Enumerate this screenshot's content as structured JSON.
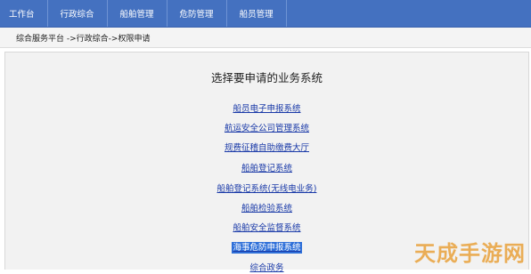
{
  "nav": {
    "tabs": [
      "工作台",
      "行政综合",
      "船舶管理",
      "危防管理",
      "船员管理"
    ]
  },
  "breadcrumb": "综合服务平台 ->行政综合->权限申请",
  "main": {
    "heading": "选择要申请的业务系统",
    "systems": [
      {
        "label": "船员电子申报系统",
        "selected": false
      },
      {
        "label": "航运安全公司管理系统",
        "selected": false
      },
      {
        "label": "规费征稽自助缴费大厅",
        "selected": false
      },
      {
        "label": "船舶登记系统",
        "selected": false
      },
      {
        "label": "船舶登记系统(无线电业务)",
        "selected": false
      },
      {
        "label": "船舶检验系统",
        "selected": false
      },
      {
        "label": "船舶安全监督系统",
        "selected": false
      },
      {
        "label": "海事危防申报系统",
        "selected": true
      },
      {
        "label": "综合政务",
        "selected": false
      }
    ]
  },
  "watermark": "天成手游网",
  "colors": {
    "nav_bg": "#4471c0",
    "link": "#1a3aa8",
    "selection_bg": "#2e6fd8"
  }
}
